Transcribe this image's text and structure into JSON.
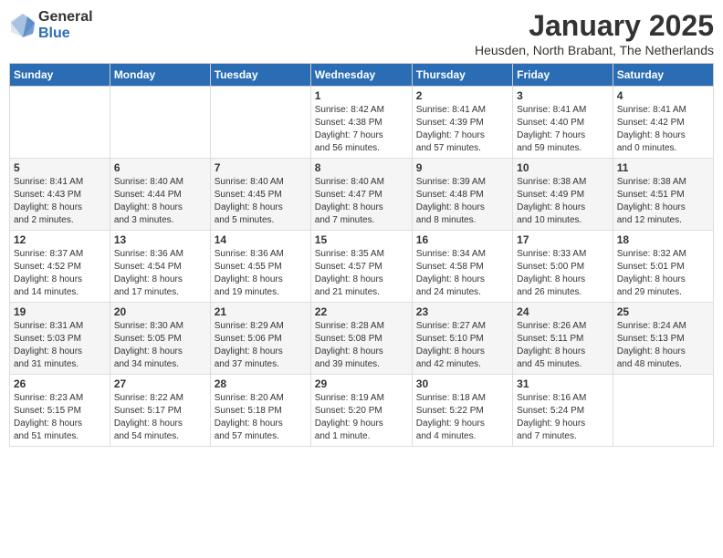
{
  "logo": {
    "general": "General",
    "blue": "Blue"
  },
  "header": {
    "title": "January 2025",
    "location": "Heusden, North Brabant, The Netherlands"
  },
  "weekdays": [
    "Sunday",
    "Monday",
    "Tuesday",
    "Wednesday",
    "Thursday",
    "Friday",
    "Saturday"
  ],
  "weeks": [
    [
      {
        "day": "",
        "info": ""
      },
      {
        "day": "",
        "info": ""
      },
      {
        "day": "",
        "info": ""
      },
      {
        "day": "1",
        "info": "Sunrise: 8:42 AM\nSunset: 4:38 PM\nDaylight: 7 hours\nand 56 minutes."
      },
      {
        "day": "2",
        "info": "Sunrise: 8:41 AM\nSunset: 4:39 PM\nDaylight: 7 hours\nand 57 minutes."
      },
      {
        "day": "3",
        "info": "Sunrise: 8:41 AM\nSunset: 4:40 PM\nDaylight: 7 hours\nand 59 minutes."
      },
      {
        "day": "4",
        "info": "Sunrise: 8:41 AM\nSunset: 4:42 PM\nDaylight: 8 hours\nand 0 minutes."
      }
    ],
    [
      {
        "day": "5",
        "info": "Sunrise: 8:41 AM\nSunset: 4:43 PM\nDaylight: 8 hours\nand 2 minutes."
      },
      {
        "day": "6",
        "info": "Sunrise: 8:40 AM\nSunset: 4:44 PM\nDaylight: 8 hours\nand 3 minutes."
      },
      {
        "day": "7",
        "info": "Sunrise: 8:40 AM\nSunset: 4:45 PM\nDaylight: 8 hours\nand 5 minutes."
      },
      {
        "day": "8",
        "info": "Sunrise: 8:40 AM\nSunset: 4:47 PM\nDaylight: 8 hours\nand 7 minutes."
      },
      {
        "day": "9",
        "info": "Sunrise: 8:39 AM\nSunset: 4:48 PM\nDaylight: 8 hours\nand 8 minutes."
      },
      {
        "day": "10",
        "info": "Sunrise: 8:38 AM\nSunset: 4:49 PM\nDaylight: 8 hours\nand 10 minutes."
      },
      {
        "day": "11",
        "info": "Sunrise: 8:38 AM\nSunset: 4:51 PM\nDaylight: 8 hours\nand 12 minutes."
      }
    ],
    [
      {
        "day": "12",
        "info": "Sunrise: 8:37 AM\nSunset: 4:52 PM\nDaylight: 8 hours\nand 14 minutes."
      },
      {
        "day": "13",
        "info": "Sunrise: 8:36 AM\nSunset: 4:54 PM\nDaylight: 8 hours\nand 17 minutes."
      },
      {
        "day": "14",
        "info": "Sunrise: 8:36 AM\nSunset: 4:55 PM\nDaylight: 8 hours\nand 19 minutes."
      },
      {
        "day": "15",
        "info": "Sunrise: 8:35 AM\nSunset: 4:57 PM\nDaylight: 8 hours\nand 21 minutes."
      },
      {
        "day": "16",
        "info": "Sunrise: 8:34 AM\nSunset: 4:58 PM\nDaylight: 8 hours\nand 24 minutes."
      },
      {
        "day": "17",
        "info": "Sunrise: 8:33 AM\nSunset: 5:00 PM\nDaylight: 8 hours\nand 26 minutes."
      },
      {
        "day": "18",
        "info": "Sunrise: 8:32 AM\nSunset: 5:01 PM\nDaylight: 8 hours\nand 29 minutes."
      }
    ],
    [
      {
        "day": "19",
        "info": "Sunrise: 8:31 AM\nSunset: 5:03 PM\nDaylight: 8 hours\nand 31 minutes."
      },
      {
        "day": "20",
        "info": "Sunrise: 8:30 AM\nSunset: 5:05 PM\nDaylight: 8 hours\nand 34 minutes."
      },
      {
        "day": "21",
        "info": "Sunrise: 8:29 AM\nSunset: 5:06 PM\nDaylight: 8 hours\nand 37 minutes."
      },
      {
        "day": "22",
        "info": "Sunrise: 8:28 AM\nSunset: 5:08 PM\nDaylight: 8 hours\nand 39 minutes."
      },
      {
        "day": "23",
        "info": "Sunrise: 8:27 AM\nSunset: 5:10 PM\nDaylight: 8 hours\nand 42 minutes."
      },
      {
        "day": "24",
        "info": "Sunrise: 8:26 AM\nSunset: 5:11 PM\nDaylight: 8 hours\nand 45 minutes."
      },
      {
        "day": "25",
        "info": "Sunrise: 8:24 AM\nSunset: 5:13 PM\nDaylight: 8 hours\nand 48 minutes."
      }
    ],
    [
      {
        "day": "26",
        "info": "Sunrise: 8:23 AM\nSunset: 5:15 PM\nDaylight: 8 hours\nand 51 minutes."
      },
      {
        "day": "27",
        "info": "Sunrise: 8:22 AM\nSunset: 5:17 PM\nDaylight: 8 hours\nand 54 minutes."
      },
      {
        "day": "28",
        "info": "Sunrise: 8:20 AM\nSunset: 5:18 PM\nDaylight: 8 hours\nand 57 minutes."
      },
      {
        "day": "29",
        "info": "Sunrise: 8:19 AM\nSunset: 5:20 PM\nDaylight: 9 hours\nand 1 minute."
      },
      {
        "day": "30",
        "info": "Sunrise: 8:18 AM\nSunset: 5:22 PM\nDaylight: 9 hours\nand 4 minutes."
      },
      {
        "day": "31",
        "info": "Sunrise: 8:16 AM\nSunset: 5:24 PM\nDaylight: 9 hours\nand 7 minutes."
      },
      {
        "day": "",
        "info": ""
      }
    ]
  ]
}
